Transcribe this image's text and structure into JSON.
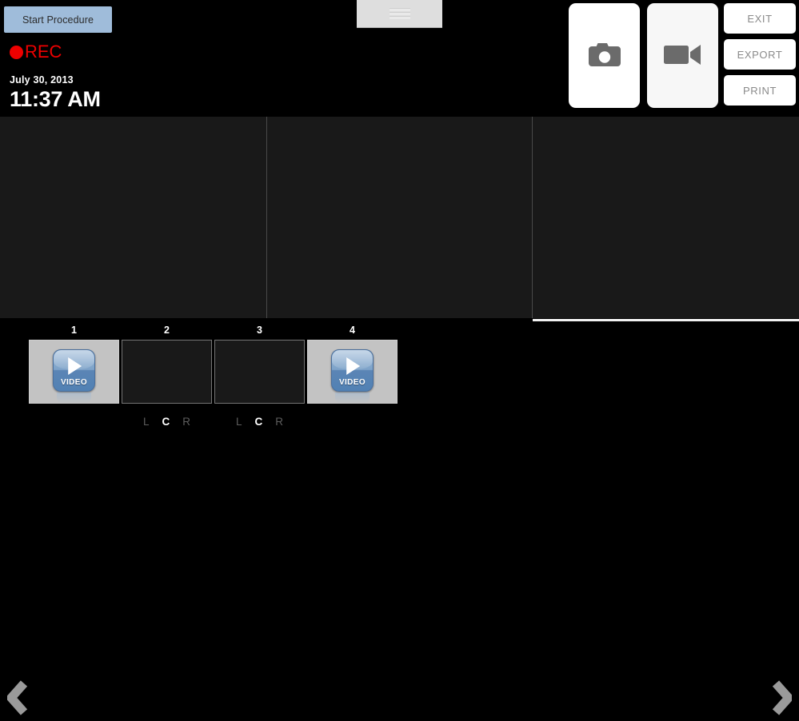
{
  "app": {
    "background": "#000000",
    "accent_blue": "#9fbcda",
    "rec_color": "#ee0000"
  },
  "toolbar": {
    "start_procedure_label": "Start Procedure",
    "recording": {
      "indicator_icon": "record-dot-icon",
      "label": "REC"
    },
    "date": "July 30, 2013",
    "time": "11:37 AM",
    "grip_handle_icon": "drag-handle-icon",
    "capture": {
      "photo_button_icon": "camera-icon",
      "video_button_icon": "camcorder-icon"
    },
    "actions": [
      {
        "label": "EXIT",
        "name": "exit-button"
      },
      {
        "label": "EXPORT",
        "name": "export-button"
      },
      {
        "label": "PRINT",
        "name": "print-button"
      }
    ]
  },
  "viewer": {
    "panes": [
      {
        "id": 1,
        "selected": false,
        "content": ""
      },
      {
        "id": 2,
        "selected": false,
        "content": ""
      },
      {
        "id": 3,
        "selected": true,
        "content": ""
      }
    ]
  },
  "filmstrip": {
    "prev_arrow_icon": "chevron-left-icon",
    "next_arrow_icon": "chevron-right-icon",
    "video_badge_label": "VIDEO",
    "video_badge_icon": "play-triangle-icon",
    "thumbnails": [
      {
        "number": "1",
        "type": "video",
        "badge_label": "VIDEO",
        "lcr": null
      },
      {
        "number": "2",
        "type": "empty",
        "badge_label": "",
        "lcr": {
          "options": [
            "L",
            "C",
            "R"
          ],
          "selected": "C"
        }
      },
      {
        "number": "3",
        "type": "empty",
        "badge_label": "",
        "lcr": {
          "options": [
            "L",
            "C",
            "R"
          ],
          "selected": "C"
        }
      },
      {
        "number": "4",
        "type": "video",
        "badge_label": "VIDEO",
        "lcr": null
      }
    ]
  }
}
